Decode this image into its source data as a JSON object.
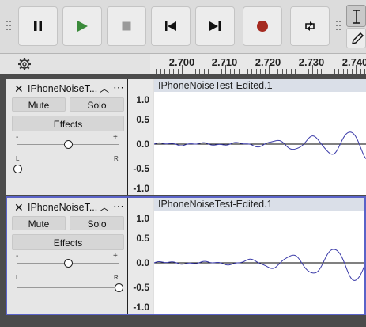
{
  "toolbar": {
    "buttons": [
      {
        "name": "pause",
        "icon": "pause-icon"
      },
      {
        "name": "play",
        "icon": "play-icon"
      },
      {
        "name": "stop",
        "icon": "stop-icon"
      },
      {
        "name": "skip-start",
        "icon": "skip-to-start-icon"
      },
      {
        "name": "skip-end",
        "icon": "skip-to-end-icon"
      },
      {
        "name": "record",
        "icon": "record-icon"
      },
      {
        "name": "loop",
        "icon": "loop-icon"
      }
    ],
    "tools": [
      "selection-tool-icon",
      "draw-tool-icon"
    ]
  },
  "ruler": {
    "settings_icon": "gear-icon",
    "ticks": [
      "2.700",
      "2.710",
      "2.720",
      "2.730",
      "2.740"
    ]
  },
  "tracks": [
    {
      "name": "IPhoneNoiseT...",
      "mute": "Mute",
      "solo": "Solo",
      "effects": "Effects",
      "gain_minus": "-",
      "gain_plus": "+",
      "pan_left": "L",
      "pan_right": "R",
      "gain_level": 0.5,
      "pan_level": 0.0,
      "clip_title": "IPhoneNoiseTest-Edited.1",
      "scale": [
        "1.0",
        "0.5",
        "0.0",
        "-0.5",
        "-1.0"
      ]
    },
    {
      "name": "IPhoneNoiseT...",
      "mute": "Mute",
      "solo": "Solo",
      "effects": "Effects",
      "gain_minus": "-",
      "gain_plus": "+",
      "pan_left": "L",
      "pan_right": "R",
      "gain_level": 0.5,
      "pan_level": 1.0,
      "clip_title": "IPhoneNoiseTest-Edited.1",
      "scale": [
        "1.0",
        "0.5",
        "0.0",
        "-0.5",
        "-1.0"
      ]
    }
  ],
  "colors": {
    "record": "#a52a20",
    "play": "#3a8a3a",
    "selection": "#5a63c8",
    "waveform": "#3a3aa8"
  }
}
